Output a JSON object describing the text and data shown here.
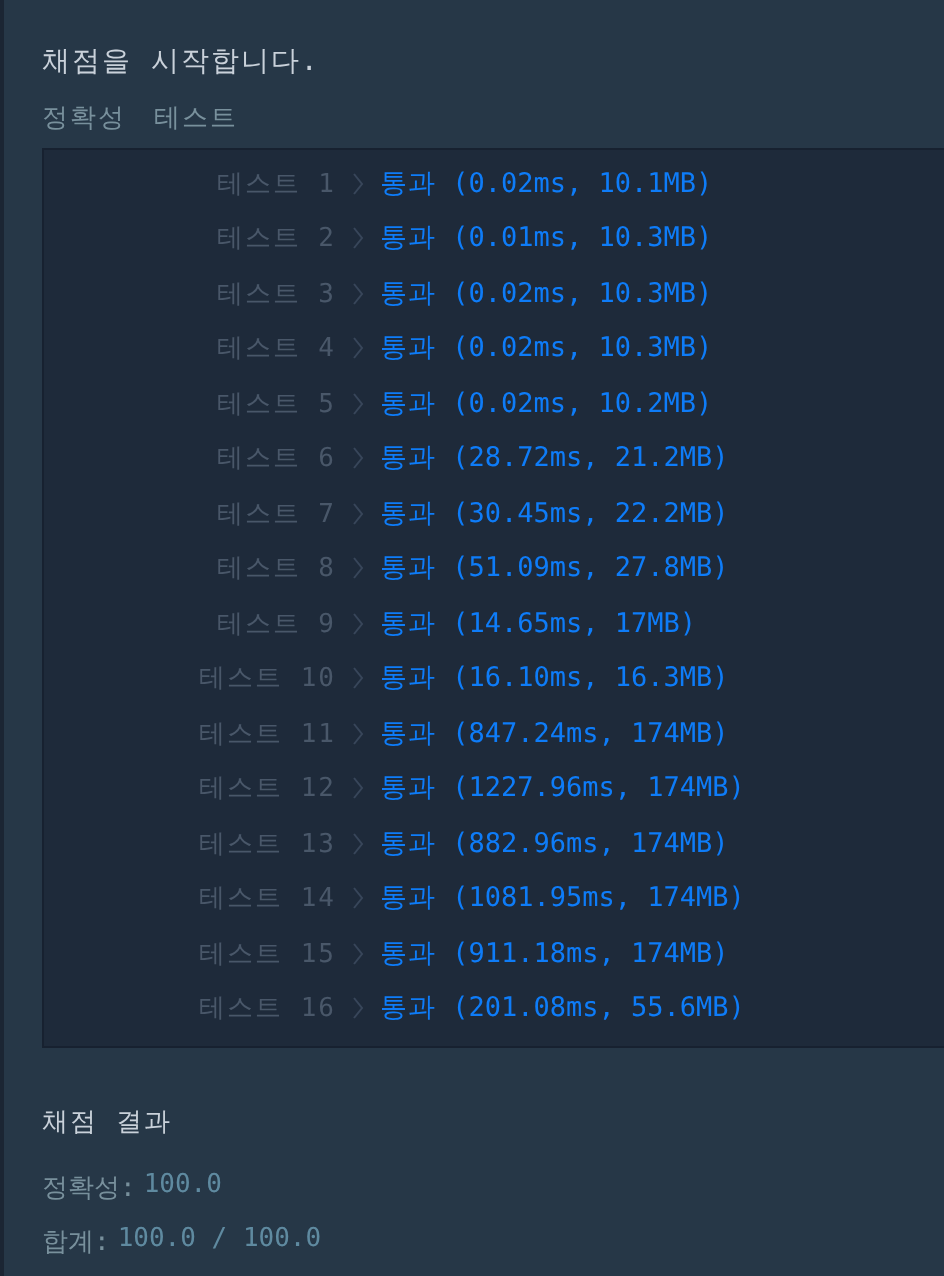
{
  "heading": "채점을 시작합니다.",
  "tabs": [
    {
      "label": "정확성",
      "selected": false
    },
    {
      "label": "테스트",
      "selected": false
    }
  ],
  "results": [
    {
      "label": "테스트 1",
      "status": "통과",
      "detail": "(0.02ms, 10.1MB)"
    },
    {
      "label": "테스트 2",
      "status": "통과",
      "detail": "(0.01ms, 10.3MB)"
    },
    {
      "label": "테스트 3",
      "status": "통과",
      "detail": "(0.02ms, 10.3MB)"
    },
    {
      "label": "테스트 4",
      "status": "통과",
      "detail": "(0.02ms, 10.3MB)"
    },
    {
      "label": "테스트 5",
      "status": "통과",
      "detail": "(0.02ms, 10.2MB)"
    },
    {
      "label": "테스트 6",
      "status": "통과",
      "detail": "(28.72ms, 21.2MB)"
    },
    {
      "label": "테스트 7",
      "status": "통과",
      "detail": "(30.45ms, 22.2MB)"
    },
    {
      "label": "테스트 8",
      "status": "통과",
      "detail": "(51.09ms, 27.8MB)"
    },
    {
      "label": "테스트 9",
      "status": "통과",
      "detail": "(14.65ms, 17MB)"
    },
    {
      "label": "테스트 10",
      "status": "통과",
      "detail": "(16.10ms, 16.3MB)"
    },
    {
      "label": "테스트 11",
      "status": "통과",
      "detail": "(847.24ms, 174MB)"
    },
    {
      "label": "테스트 12",
      "status": "통과",
      "detail": "(1227.96ms, 174MB)"
    },
    {
      "label": "테스트 13",
      "status": "통과",
      "detail": "(882.96ms, 174MB)"
    },
    {
      "label": "테스트 14",
      "status": "통과",
      "detail": "(1081.95ms, 174MB)"
    },
    {
      "label": "테스트 15",
      "status": "통과",
      "detail": "(911.18ms, 174MB)"
    },
    {
      "label": "테스트 16",
      "status": "통과",
      "detail": "(201.08ms, 55.6MB)"
    }
  ],
  "summary": {
    "title": "채점 결과",
    "lines": [
      {
        "label": "정확성:",
        "value": "100.0"
      },
      {
        "label": "합계:",
        "value": "100.0 / 100.0"
      }
    ]
  }
}
